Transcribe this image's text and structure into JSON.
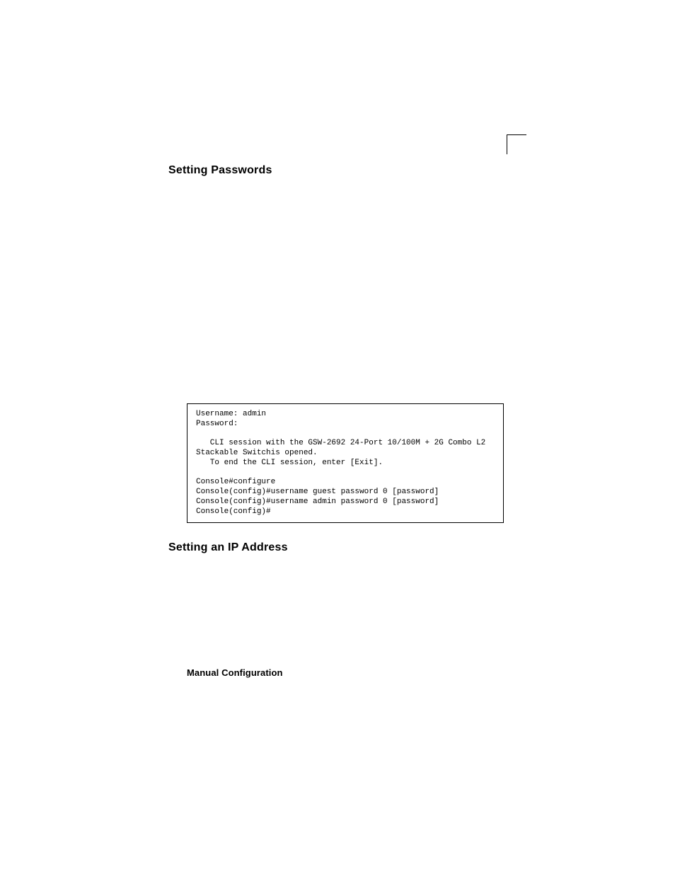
{
  "headings": {
    "setting_passwords": "Setting Passwords",
    "setting_ip": "Setting an IP Address",
    "manual_config": "Manual Configuration"
  },
  "code_block": "Username: admin\nPassword:\n\n   CLI session with the GSW-2692 24-Port 10/100M + 2G Combo L2 \nStackable Switchis opened.\n   To end the CLI session, enter [Exit].\n\nConsole#configure\nConsole(config)#username guest password 0 [password]\nConsole(config)#username admin password 0 [password]\nConsole(config)#"
}
